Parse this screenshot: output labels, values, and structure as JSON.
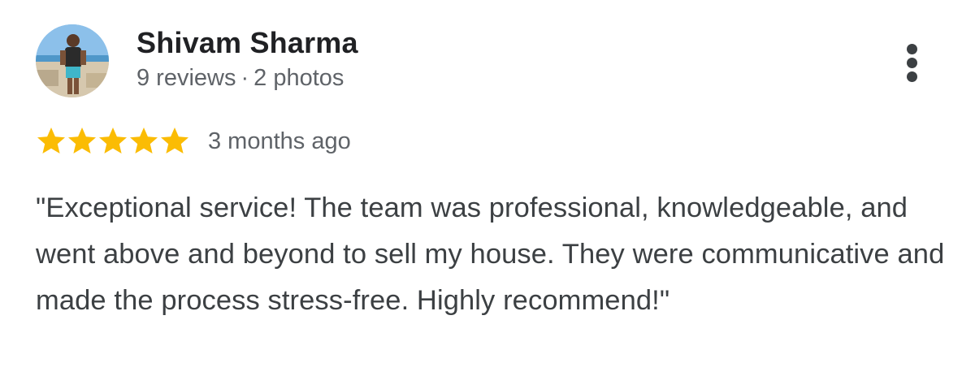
{
  "reviewer": {
    "name": "Shivam Sharma",
    "reviews_count": "9 reviews",
    "separator": "·",
    "photos_count": "2 photos"
  },
  "rating": {
    "stars": 5,
    "max_stars": 5,
    "star_color": "#fbbc04",
    "time_ago": "3 months ago"
  },
  "review": {
    "text": "\"Exceptional service! The team was professional, knowledgeable, and went above and beyond to sell my house. They were communicative and made the process stress-free. Highly recommend!\""
  },
  "icons": {
    "menu": "more-vert-icon",
    "star": "star-icon"
  }
}
